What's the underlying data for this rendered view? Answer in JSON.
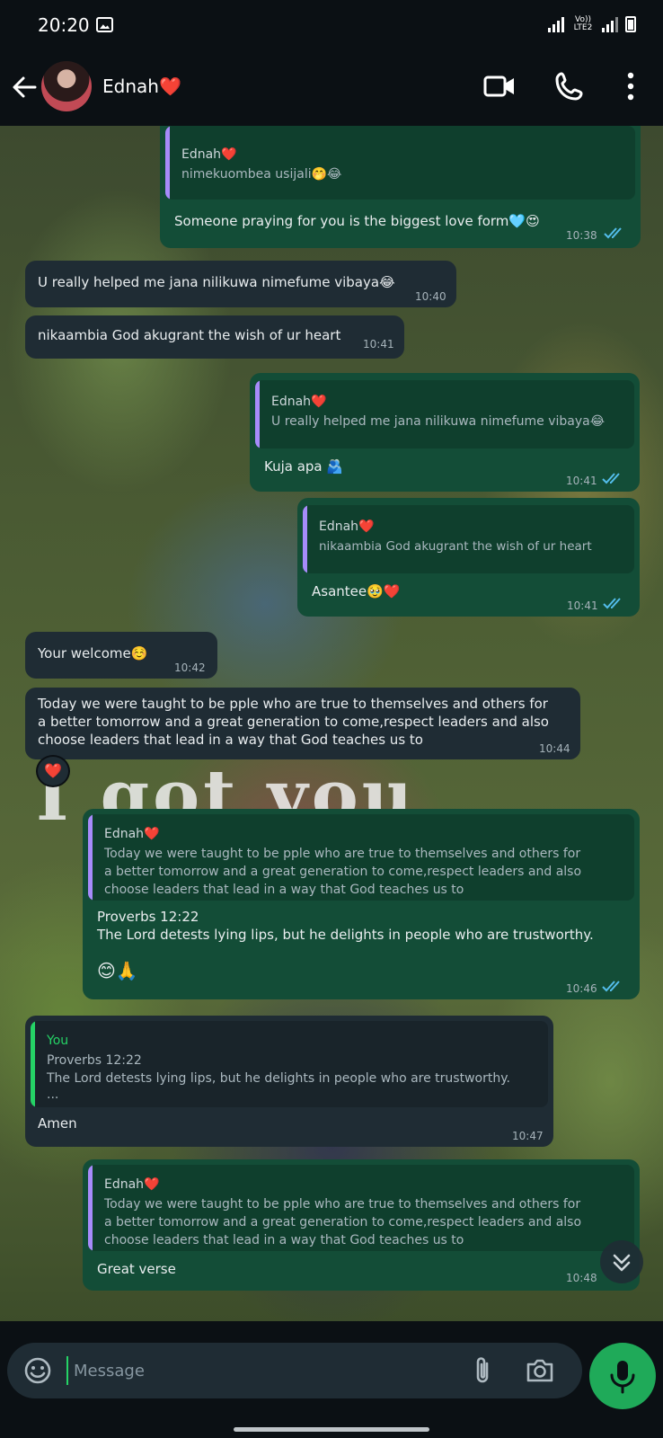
{
  "status_bar": {
    "time": "20:20",
    "network_label": "Vo)) LTE2"
  },
  "header": {
    "contact_name": "Ednah❤️"
  },
  "background": {
    "caption": "I got you"
  },
  "messages": [
    {
      "quote_author": "Ednah❤️",
      "quote_text": "nimekuombea usijali🤭😂",
      "text": "Someone praying for you is the biggest love form🩵😍",
      "time": "10:38"
    },
    {
      "text": "U really helped me jana nilikuwa nimefume vibaya😂",
      "time": "10:40"
    },
    {
      "text": "nikaambia God akugrant the wish of ur heart",
      "time": "10:41"
    },
    {
      "quote_author": "Ednah❤️",
      "quote_text": "U really helped me jana nilikuwa nimefume vibaya😂",
      "text": "Kuja apa 🫂",
      "time": "10:41"
    },
    {
      "quote_author": "Ednah❤️",
      "quote_text": "nikaambia God akugrant the wish of ur heart",
      "text": "Asantee🥹❤️",
      "time": "10:41"
    },
    {
      "text": "Your welcome☺️",
      "time": "10:42"
    },
    {
      "lines": [
        "Today we were taught to be pple who are true to themselves and others for",
        "a better tomorrow and a great generation to come,respect leaders and also",
        "choose leaders that lead in a way that God teaches us to"
      ],
      "time": "10:44",
      "reaction": "❤️"
    },
    {
      "quote_author": "Ednah❤️",
      "quote_lines": [
        "Today we were taught to be pple who are true to themselves and others for",
        "a better tomorrow and a great generation to come,respect leaders and also",
        "choose leaders that lead in a way that God teaches us to"
      ],
      "lines": [
        "Proverbs 12:22",
        "The Lord detests lying lips, but he delights in people who are trustworthy."
      ],
      "emoji": "😊🙏",
      "time": "10:46"
    },
    {
      "quote_author": "You",
      "quote_lines": [
        "Proverbs 12:22",
        "The Lord detests lying lips, but he delights in people who are trustworthy.",
        "..."
      ],
      "text": "Amen",
      "time": "10:47"
    },
    {
      "quote_author": "Ednah❤️",
      "quote_lines": [
        "Today we were taught to be pple who are true to themselves and others for",
        "a better tomorrow and a great generation to come,respect leaders and also",
        "choose leaders that lead in a way that God teaches us to"
      ],
      "text": "Great verse",
      "time": "10:48"
    }
  ],
  "composer": {
    "placeholder": "Message"
  },
  "colors": {
    "outgoing": "#134d37",
    "incoming": "#1f2c34",
    "accent": "#25d366",
    "tick_read": "#53bdeb"
  },
  "icons": [
    "back-arrow-icon",
    "video-call-icon",
    "phone-icon",
    "more-vert-icon",
    "emoji-icon",
    "attach-icon",
    "camera-icon",
    "mic-icon",
    "double-check-icon",
    "chevron-down-icon"
  ]
}
